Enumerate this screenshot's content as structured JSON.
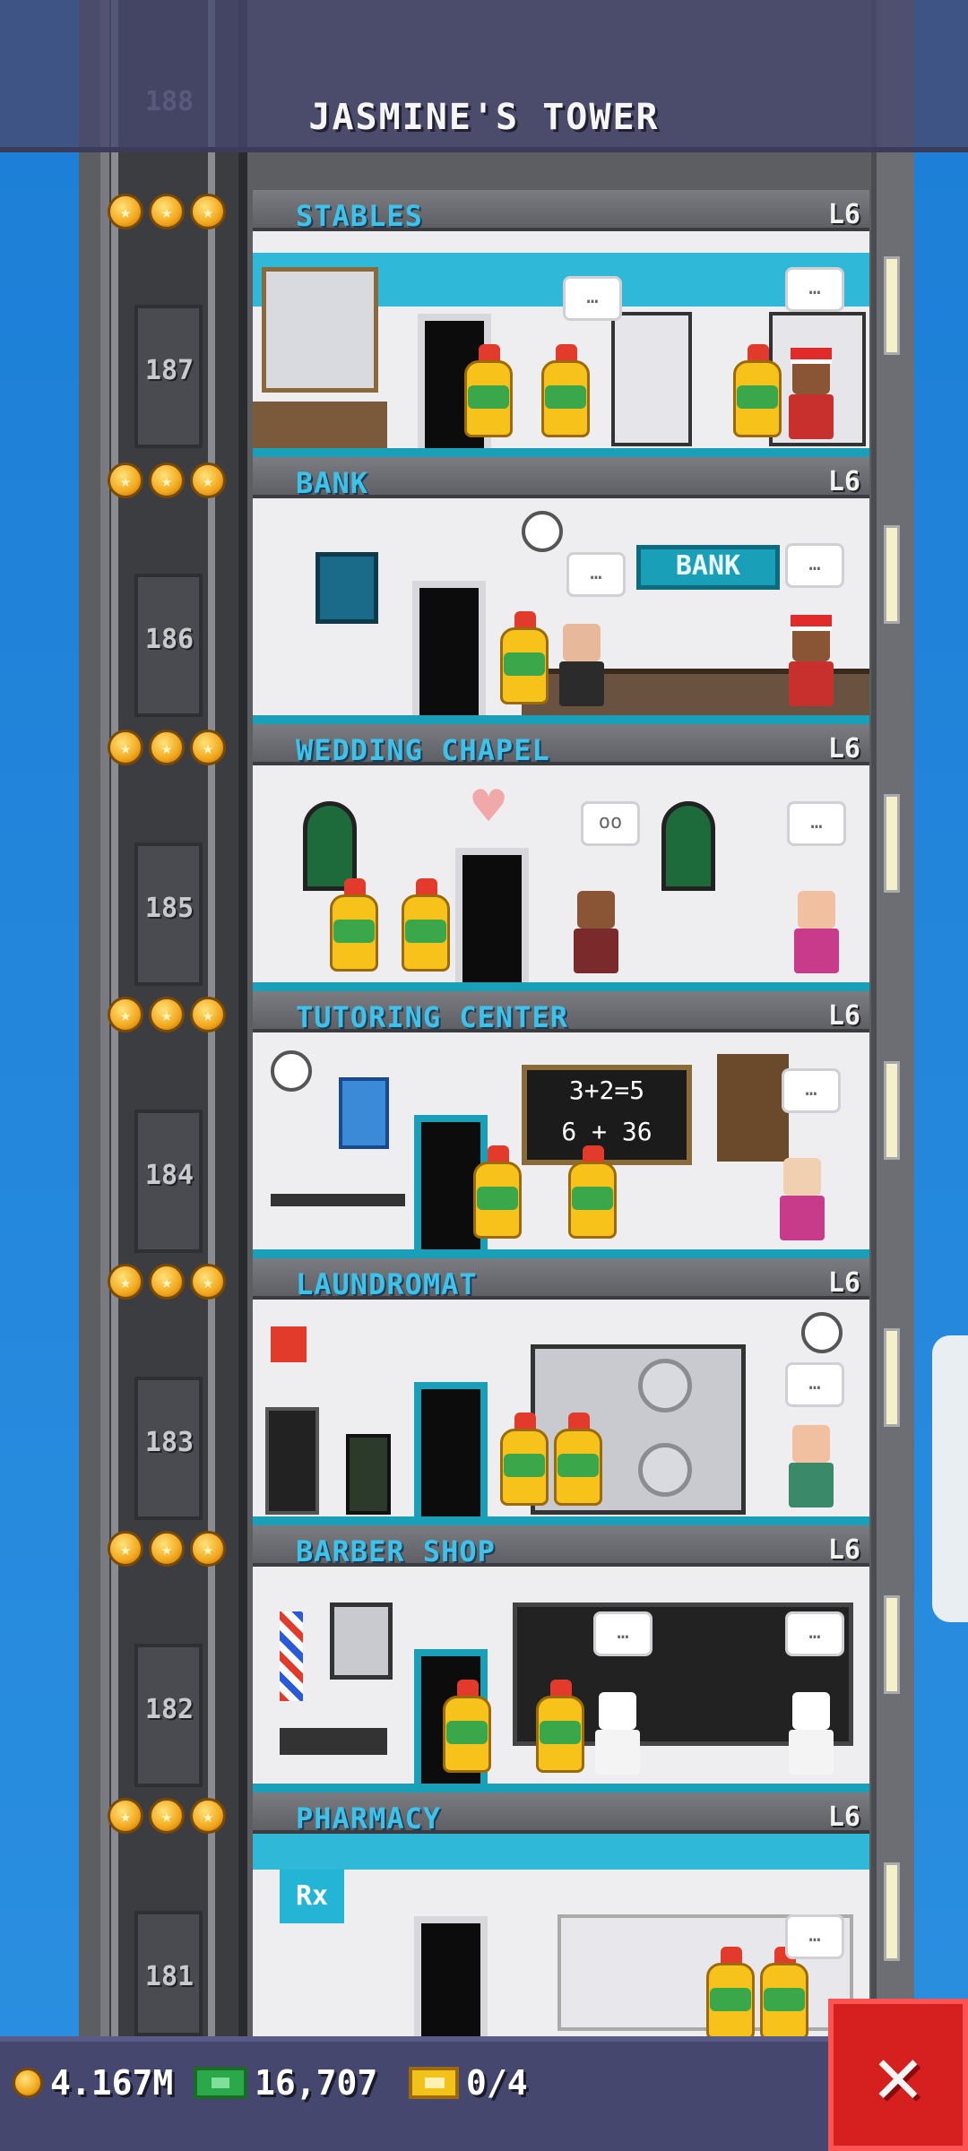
{
  "header": {
    "title": "JASMINE'S TOWER",
    "top_floor_number": "188"
  },
  "floors": [
    {
      "number": "187",
      "name": "STABLES",
      "level": "L6",
      "stars": 3
    },
    {
      "number": "186",
      "name": "BANK",
      "level": "L6",
      "stars": 3,
      "sign": "BANK"
    },
    {
      "number": "185",
      "name": "WEDDING CHAPEL",
      "level": "L6",
      "stars": 3
    },
    {
      "number": "184",
      "name": "TUTORING CENTER",
      "level": "L6",
      "stars": 3,
      "board": "3+2=5\n6 + 36"
    },
    {
      "number": "183",
      "name": "LAUNDROMAT",
      "level": "L6",
      "stars": 3
    },
    {
      "number": "182",
      "name": "BARBER SHOP",
      "level": "L6",
      "stars": 3
    },
    {
      "number": "181",
      "name": "PHARMACY",
      "level": "L6",
      "stars": 3,
      "sign": "Rx"
    }
  ],
  "status_bar": {
    "coins": "4.167M",
    "bux": "16,707",
    "tickets": "0/4"
  },
  "icons": {
    "coin": "coin-icon",
    "bux": "bux-icon",
    "ticket": "ticket-icon",
    "close": "close-icon"
  },
  "colors": {
    "sky": "#1f7fd0",
    "accent": "#3ec2ea",
    "close": "#d61f1f"
  }
}
